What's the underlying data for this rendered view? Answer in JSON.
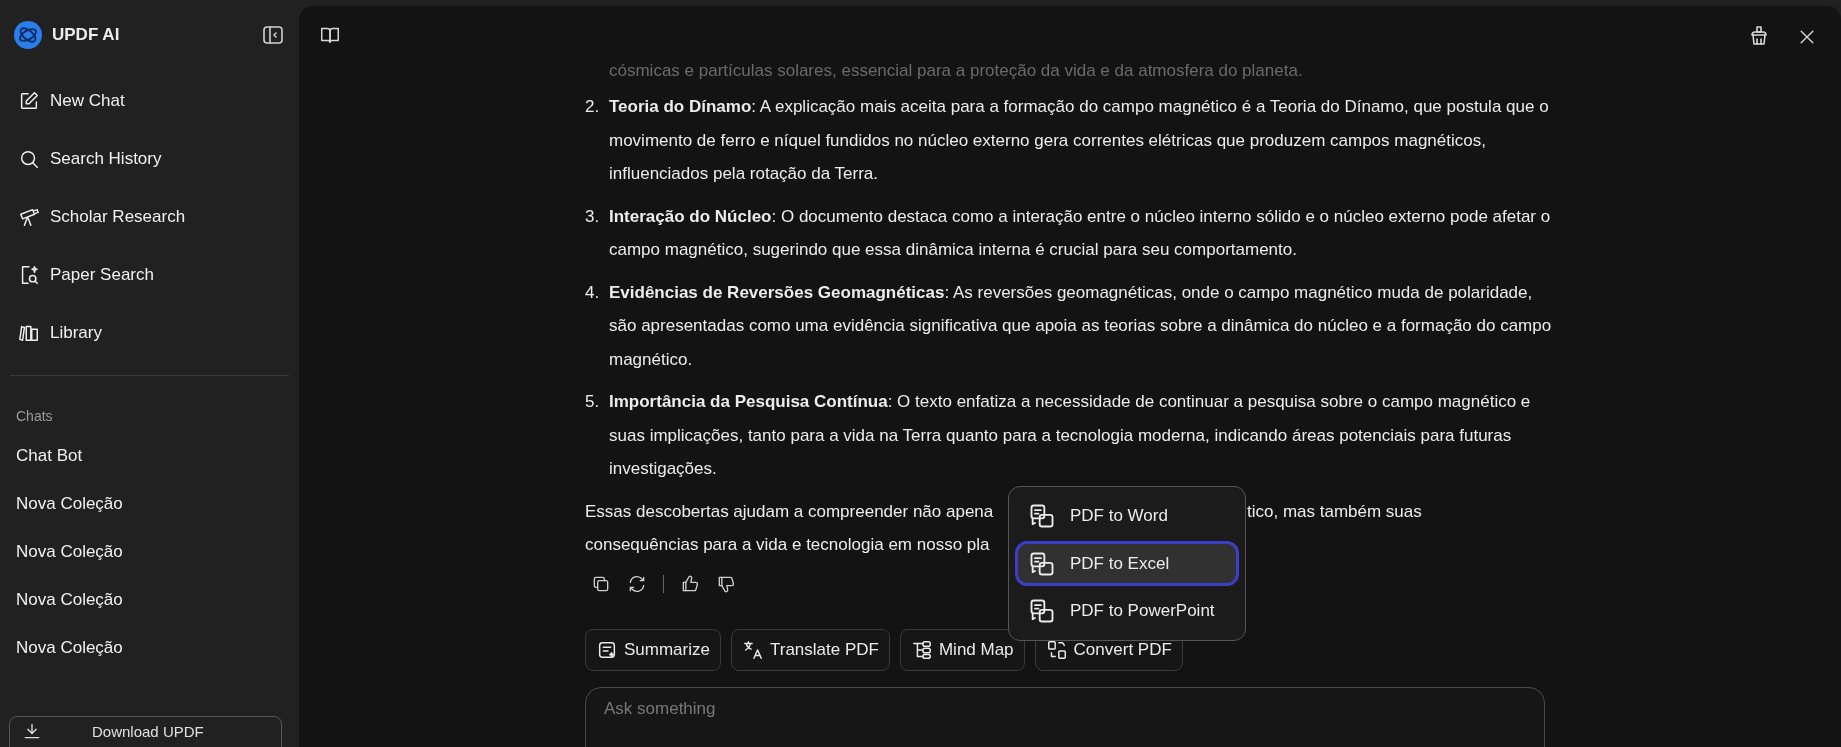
{
  "sidebar": {
    "app_name": "UPDF AI",
    "nav_items": [
      {
        "label": "New Chat"
      },
      {
        "label": "Search History"
      },
      {
        "label": "Scholar Research"
      },
      {
        "label": "Paper Search"
      },
      {
        "label": "Library"
      }
    ],
    "section_title": "Chats",
    "chats": [
      {
        "label": "Chat Bot"
      },
      {
        "label": "Nova Coleção"
      },
      {
        "label": "Nova Coleção"
      },
      {
        "label": "Nova Coleção"
      },
      {
        "label": "Nova Coleção"
      }
    ],
    "download_button": "Download UPDF"
  },
  "answer": {
    "faded_line": "cósmicas e partículas solares, essencial para a proteção da vida e da atmosfera do planeta.",
    "list_items": [
      {
        "number": "2.",
        "text": "**Teoria do Dínamo**: A explicação mais aceita para a formação do campo magnético é a Teoria do Dínamo, que postula que o movimento de ferro e níquel fundidos no núcleo externo gera correntes elétricas que produzem campos magnéticos, influenciados pela rotação da Terra."
      },
      {
        "number": "3.",
        "text": "**Interação do Núcleo**: O documento destaca como a interação entre o núcleo interno sólido e o núcleo externo pode afetar o campo magnético, sugerindo que essa dinâmica interna é crucial para seu comportamento."
      },
      {
        "number": "4.",
        "text": "**Evidências de Reversões Geomagnéticas**: As reversões geomagnéticas, onde o campo magnético muda de polaridade, são apresentadas como uma evidência significativa que apoia as teorias sobre a dinâmica do núcleo e a formação do campo magnético."
      },
      {
        "number": "5.",
        "text": "**Importância da Pesquisa Contínua**: O texto enfatiza a necessidade de continuar a pesquisa sobre o campo magnético e suas implicações, tanto para a vida na Terra quanto para a tecnologia moderna, indicando áreas potenciais para futuras investigações."
      }
    ],
    "closing_line_1_left": "Essas descobertas ajudam a compreender não apena",
    "closing_line_1_right": "tico, mas também suas",
    "closing_line_2": "consequências para a vida e tecnologia em nosso pla"
  },
  "convert_menu": [
    {
      "label": "PDF to Word",
      "selected": false
    },
    {
      "label": "PDF to Excel",
      "selected": true
    },
    {
      "label": "PDF to PowerPoint",
      "selected": false
    }
  ],
  "tool_buttons": [
    {
      "label": "Summarize"
    },
    {
      "label": "Translate PDF"
    },
    {
      "label": "Mind Map"
    },
    {
      "label": "Convert PDF"
    }
  ],
  "input": {
    "placeholder": "Ask something"
  }
}
